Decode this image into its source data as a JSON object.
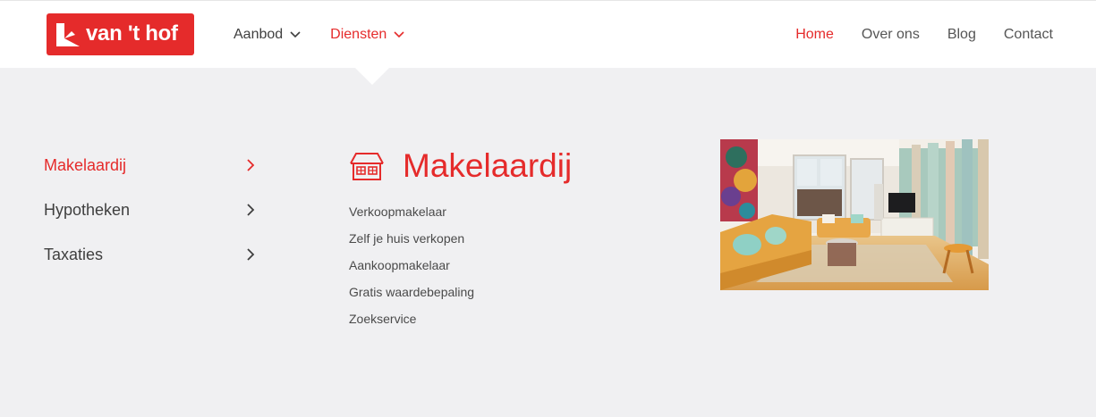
{
  "brand": {
    "logo_text": "van 't hof"
  },
  "nav": {
    "left": [
      {
        "label": "Aanbod",
        "state": "default"
      },
      {
        "label": "Diensten",
        "state": "active"
      }
    ],
    "right": [
      {
        "label": "Home",
        "state": "active"
      },
      {
        "label": "Over ons",
        "state": "default"
      },
      {
        "label": "Blog",
        "state": "default"
      },
      {
        "label": "Contact",
        "state": "default"
      }
    ]
  },
  "mega_menu": {
    "categories": [
      {
        "label": "Makelaardij",
        "state": "active"
      },
      {
        "label": "Hypotheken",
        "state": "default"
      },
      {
        "label": "Taxaties",
        "state": "default"
      }
    ],
    "section": {
      "title": "Makelaardij",
      "icon": "house-icon",
      "links": [
        "Verkoopmakelaar",
        "Zelf je huis verkopen",
        "Aankoopmakelaar",
        "Gratis waardebepaling",
        "Zoekservice"
      ]
    },
    "image": {
      "subject": "living-room-photo"
    }
  },
  "colors": {
    "accent": "#e52b2b",
    "text": "#3f3f3f",
    "panel": "#f0f0f2",
    "header": "#ffffff"
  }
}
